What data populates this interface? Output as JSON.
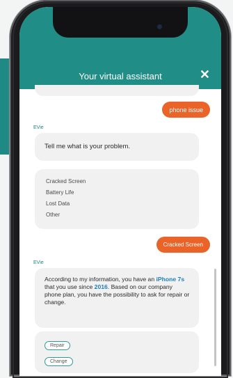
{
  "header": {
    "title": "Your virtual assistant",
    "close_glyph": "✕"
  },
  "chat": {
    "top_user_message": "phone issue",
    "bot_name_1": "EVie",
    "bot_question": "Tell me what is your problem.",
    "options": [
      "Cracked Screen",
      "Battery Life",
      "Lost Data",
      "Other"
    ],
    "user_choice": "Cracked Screen",
    "bot_name_2": "EVie",
    "info": {
      "part1": "According to my information, you have an ",
      "device": "iPhone 7s",
      "part2": " that you use since ",
      "year": "2016",
      "part3": ". Based on our company phone plan, you have the possibility to ask for repair or change."
    },
    "action_buttons": [
      "Repair",
      "Change"
    ]
  },
  "colors": {
    "teal": "#208d86",
    "orange": "#ea6329",
    "bubble": "#f1f1f1"
  },
  "icons": {
    "close": "close-icon",
    "camera": "front-camera-icon"
  }
}
